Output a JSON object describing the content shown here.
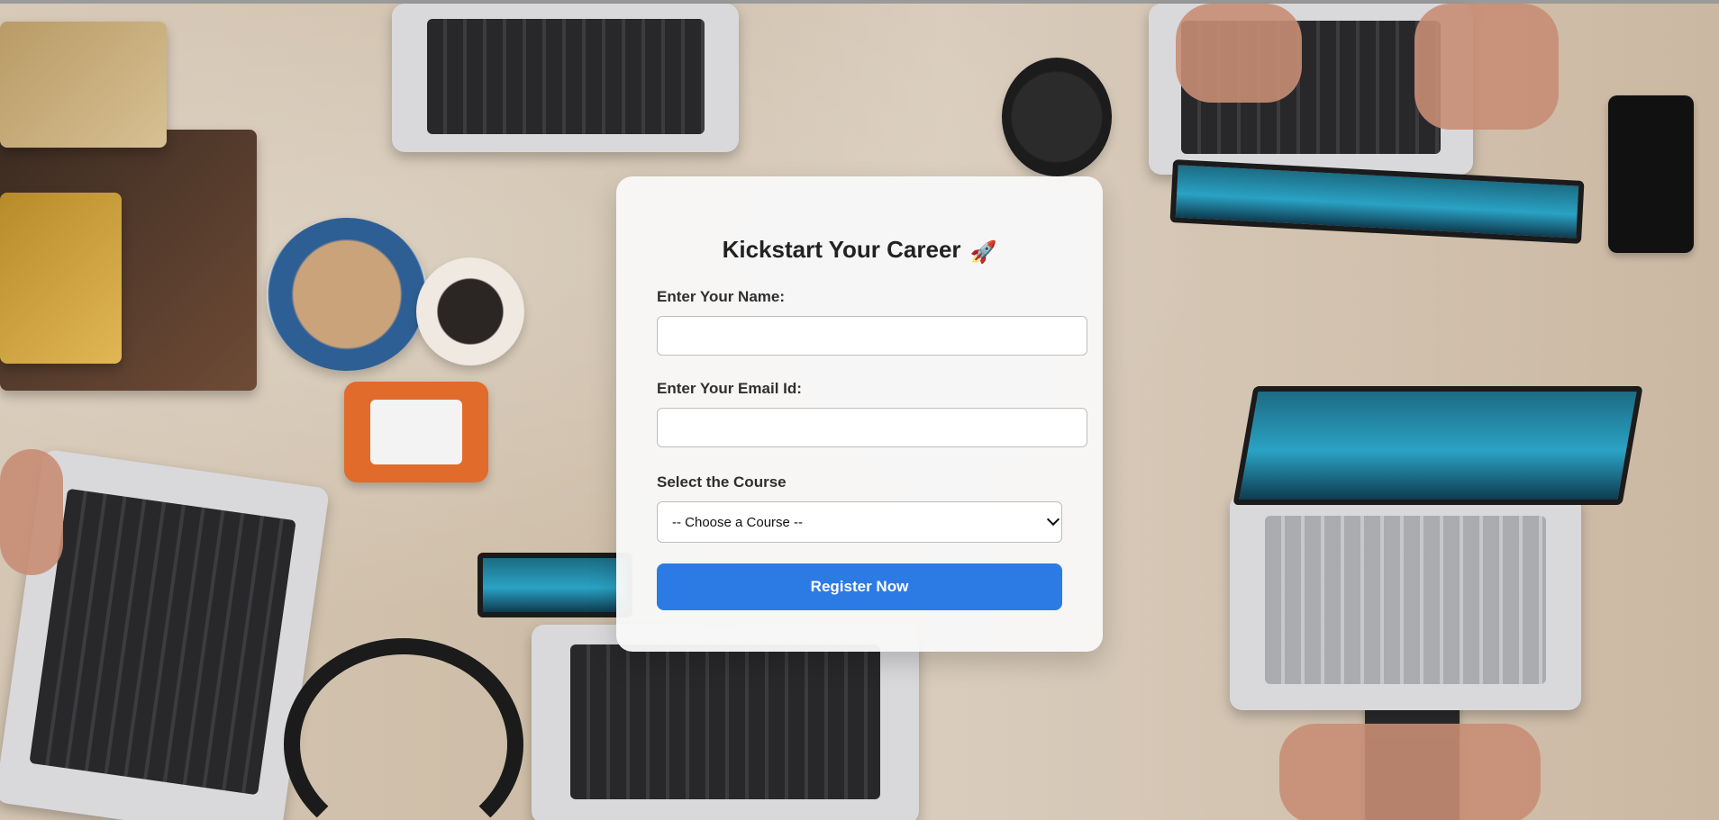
{
  "form": {
    "title": "Kickstart Your Career",
    "title_icon": "rocket-icon",
    "name_label": "Enter Your Name:",
    "name_value": "",
    "email_label": "Enter Your Email Id:",
    "email_value": "",
    "course_label": "Select the Course",
    "course_selected": "-- Choose a Course --",
    "button_label": "Register Now",
    "colors": {
      "button_background": "#2c7be5",
      "button_text": "#ffffff",
      "card_background": "#f8f8f8"
    }
  }
}
